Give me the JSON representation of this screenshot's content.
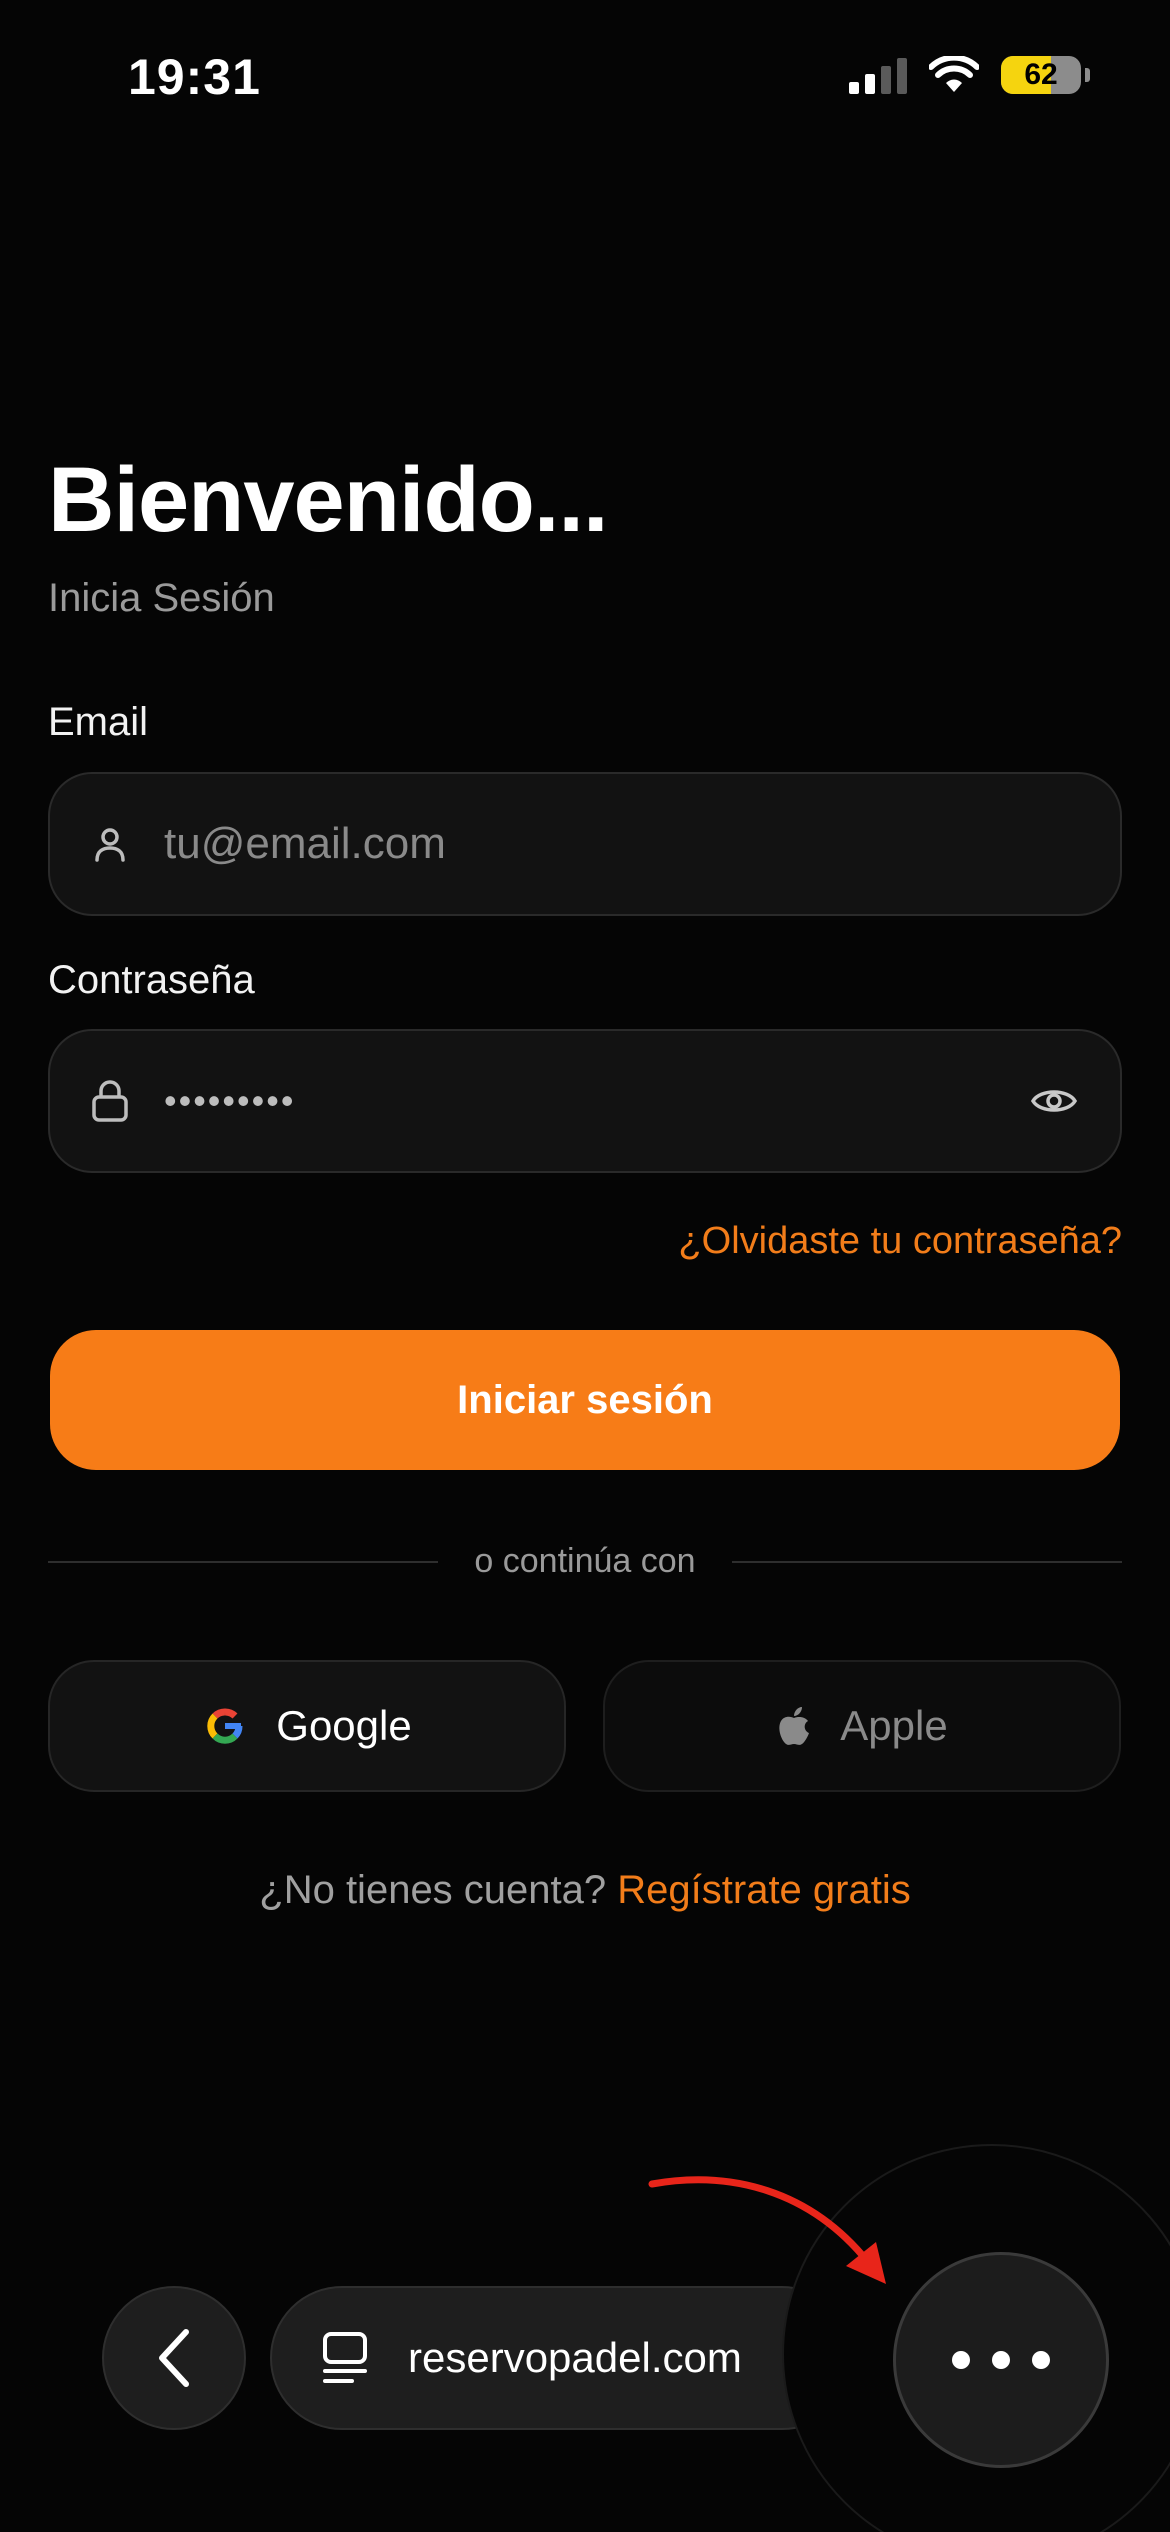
{
  "status_bar": {
    "time": "19:31",
    "battery": "62",
    "battery_level": 0.62
  },
  "login": {
    "title": "Bienvenido...",
    "subtitle": "Inicia Sesión",
    "email_label": "Email",
    "email_placeholder": "tu@email.com",
    "password_label": "Contraseña",
    "password_value": "•••••••••",
    "forgot_link": "¿Olvidaste tu contraseña?",
    "submit_label": "Iniciar sesión",
    "divider_text": "o continúa con",
    "google_label": "Google",
    "apple_label": "Apple",
    "register_prompt": "¿No tienes cuenta?",
    "register_link": "Regístrate gratis"
  },
  "browser": {
    "url": "reservopadel.com"
  },
  "colors": {
    "accent": "#f77c17",
    "link": "#f27d1a",
    "background": "#050505",
    "arrow": "#e8251a"
  }
}
